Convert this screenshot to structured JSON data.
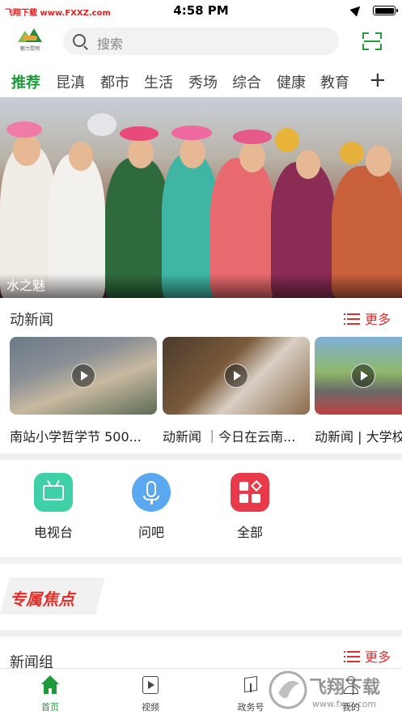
{
  "status_bar": {
    "carrier": "飞翔下载 www.FXXZ.com",
    "time": "4:58 PM"
  },
  "header": {
    "logo_text": "魅力昆明",
    "search_placeholder": "搜索",
    "scan_icon": "scan-icon"
  },
  "channels": [
    "推荐",
    "昆滇",
    "都市",
    "生活",
    "秀场",
    "综合",
    "健康",
    "教育"
  ],
  "active_channel": "推荐",
  "add_channel_label": "+",
  "banner": {
    "caption": "水之魅",
    "dot_count": 5,
    "active_dot": 0
  },
  "news_section": {
    "title": "动新闻",
    "more_label": "更多",
    "videos": [
      {
        "title": "南站小学哲学节 500..."
      },
      {
        "title": "动新闻 ｜今日在云南..."
      },
      {
        "title": "动新闻 | 大学校"
      }
    ]
  },
  "quick_entries": [
    {
      "label": "电视台",
      "icon": "tv-icon",
      "color": "#3fd0a8"
    },
    {
      "label": "问吧",
      "icon": "microphone-icon",
      "color": "#5aa8f0"
    },
    {
      "label": "全部",
      "icon": "apps-grid-icon",
      "color": "#e83a4a"
    }
  ],
  "focus_section": {
    "title": "专属焦点"
  },
  "group_section": {
    "title": "新闻组",
    "more_label": "更多"
  },
  "tab_bar": [
    {
      "label": "首页",
      "icon": "home-icon",
      "active": true
    },
    {
      "label": "视频",
      "icon": "video-icon",
      "active": false
    },
    {
      "label": "政务号",
      "icon": "cube-icon",
      "active": false
    },
    {
      "label": "我的",
      "icon": "profile-icon",
      "active": false
    }
  ],
  "watermark": {
    "title": "飞翔下载",
    "url": "www.fxxz.com"
  },
  "colors": {
    "accent_green": "#1e9a3b",
    "accent_red": "#d83232"
  }
}
